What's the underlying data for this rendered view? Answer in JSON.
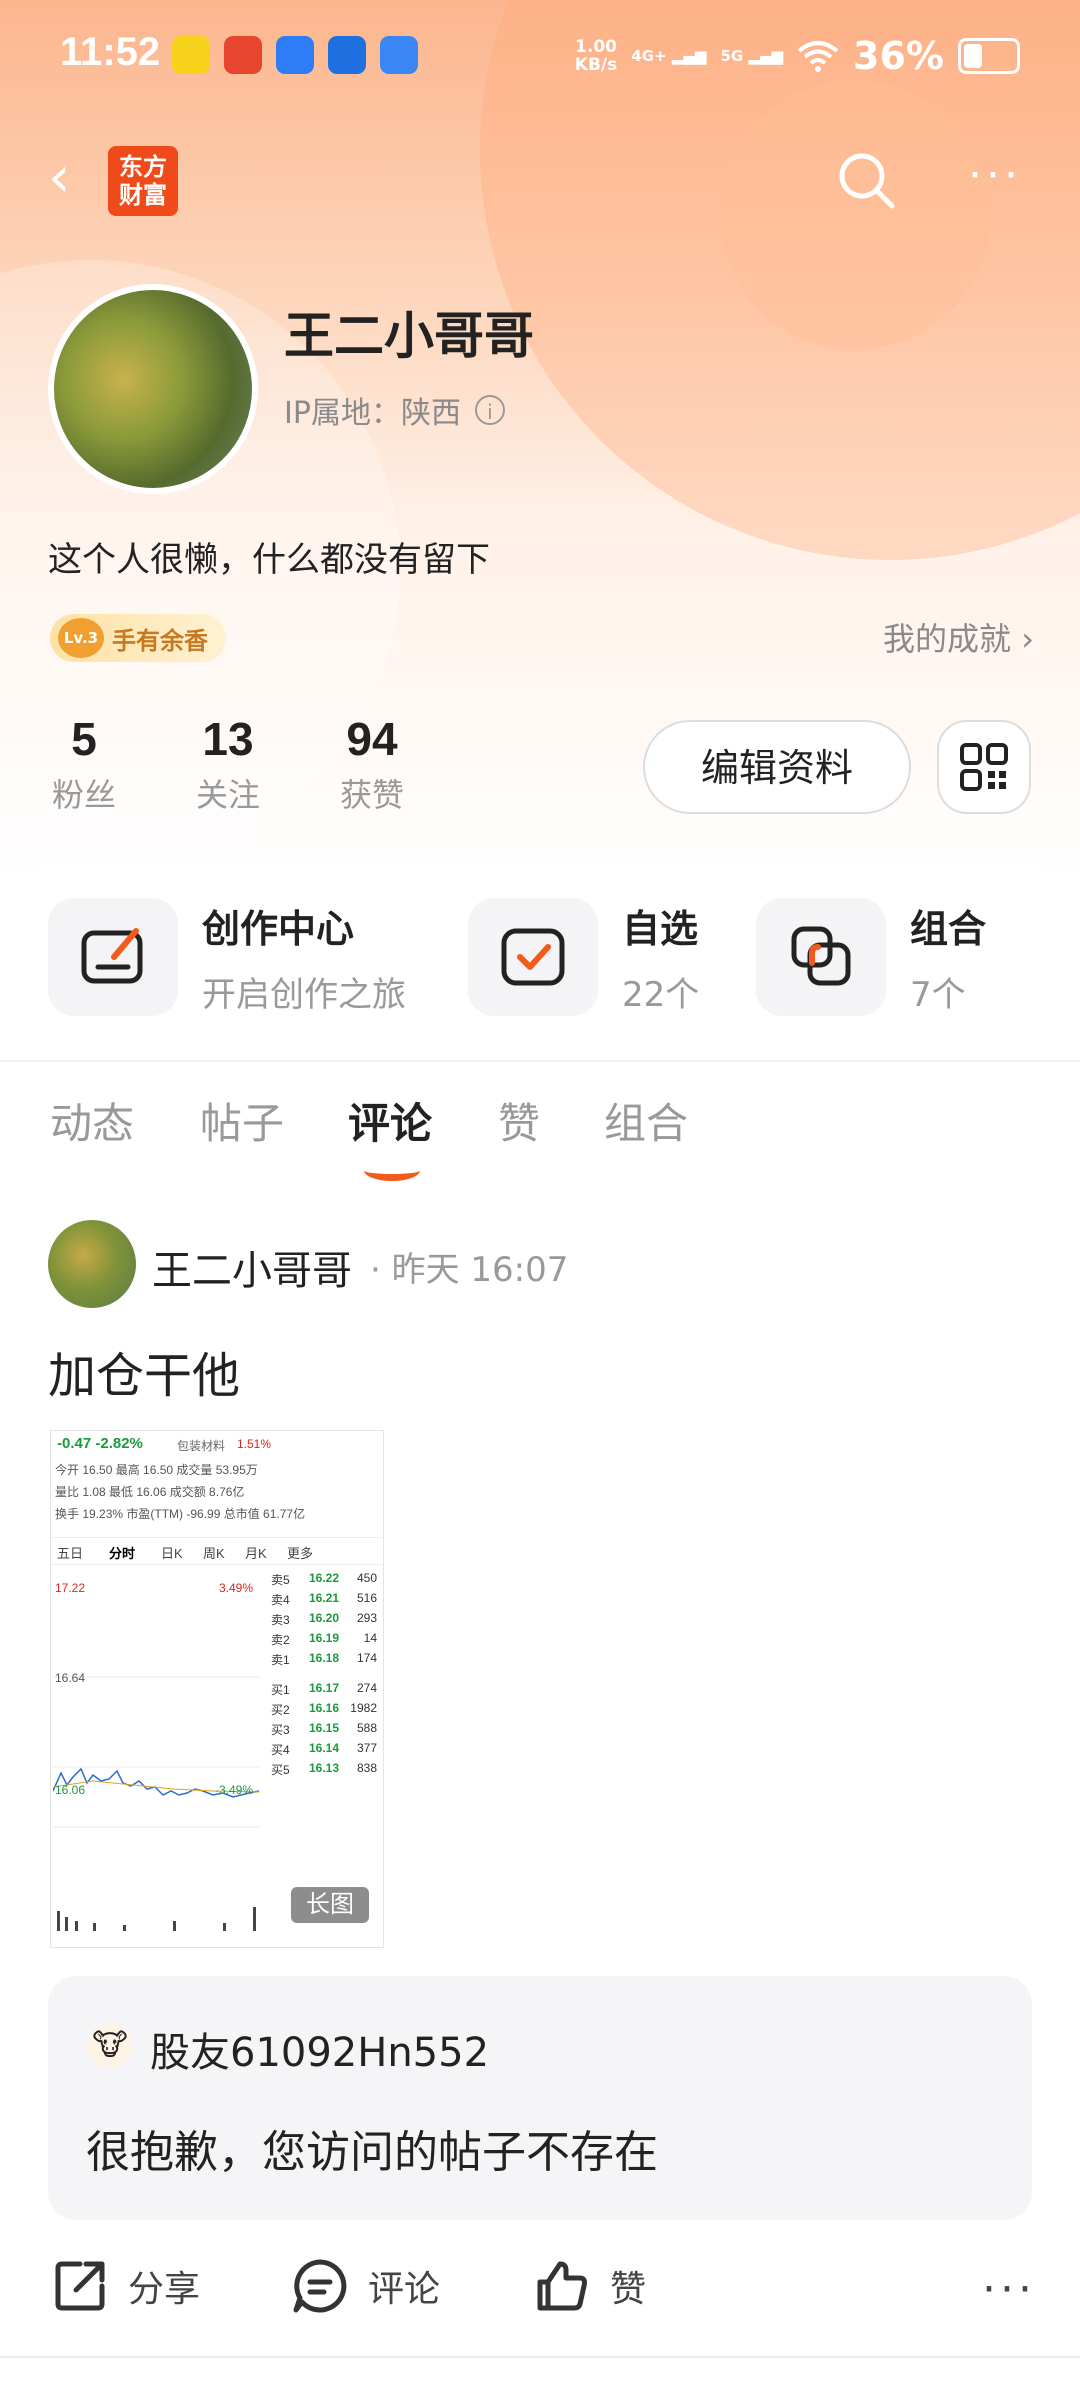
{
  "status_bar": {
    "time": "11:52",
    "network_speed_value": "1.00",
    "network_speed_unit": "KB/s",
    "signal_1": "4G+",
    "signal_2": "5G",
    "battery": "36%",
    "app_icon_colors": [
      "#f7d21b",
      "#e8452e",
      "#2e7cf6",
      "#1f6fe0",
      "#3a86f5"
    ]
  },
  "nav": {
    "logo_line1": "东方",
    "logo_line2": "财富",
    "back_icon": "chevron-left-icon",
    "search_icon": "search-icon",
    "more_icon": "more-dots-icon"
  },
  "profile": {
    "username": "王二小哥哥",
    "ip_label": "IP属地：陕西",
    "bio": "这个人很懒，什么都没有留下",
    "level_badge": "Lv.3",
    "level_title": "手有余香",
    "achievements": "我的成就"
  },
  "stats": [
    {
      "value": "5",
      "label": "粉丝"
    },
    {
      "value": "13",
      "label": "关注"
    },
    {
      "value": "94",
      "label": "获赞"
    }
  ],
  "edit_profile_label": "编辑资料",
  "quick_actions": [
    {
      "title": "创作中心",
      "subtitle": "开启创作之旅"
    },
    {
      "title": "自选",
      "subtitle": "22个"
    },
    {
      "title": "组合",
      "subtitle": "7个"
    }
  ],
  "tabs": [
    "动态",
    "帖子",
    "评论",
    "赞",
    "组合"
  ],
  "active_tab": "评论",
  "post": {
    "author": "王二小哥哥",
    "time": "· 昨天 16:07",
    "text": "加仓干他",
    "image_tag": "长图",
    "screenshot": {
      "change": "-0.47  -2.82%",
      "sector": "包装材料",
      "sector_change": "1.51%",
      "rows": [
        "今开  16.50  最高  16.50  成交量  53.95万",
        "量比  1.08  最低  16.06  成交额  8.76亿",
        "换手  19.23%  市盈(TTM)  -96.99  总市值  61.77亿"
      ],
      "kline_tabs": [
        "五日",
        "分时",
        "日K",
        "周K",
        "月K",
        "更多"
      ],
      "price_high": "17.22",
      "price_mid": "16.64",
      "price_low": "16.06",
      "pct_high": "3.49%",
      "pct_low": "-3.49%",
      "book_asks": [
        {
          "k": "卖5",
          "p": "16.22",
          "v": "450"
        },
        {
          "k": "卖4",
          "p": "16.21",
          "v": "516"
        },
        {
          "k": "卖3",
          "p": "16.20",
          "v": "293"
        },
        {
          "k": "卖2",
          "p": "16.19",
          "v": "14"
        },
        {
          "k": "卖1",
          "p": "16.18",
          "v": "174"
        }
      ],
      "book_bids": [
        {
          "k": "买1",
          "p": "16.17",
          "v": "274"
        },
        {
          "k": "买2",
          "p": "16.16",
          "v": "1982"
        },
        {
          "k": "买3",
          "p": "16.15",
          "v": "588"
        },
        {
          "k": "买4",
          "p": "16.14",
          "v": "377"
        },
        {
          "k": "买5",
          "p": "16.13",
          "v": "838"
        }
      ]
    }
  },
  "quote": {
    "user": "股友61092Hn552",
    "message": "很抱歉，您访问的帖子不存在"
  },
  "actions": {
    "share": "分享",
    "comment": "评论",
    "like": "赞"
  },
  "colors": {
    "accent": "#f35a1c",
    "logo_bg": "#ee4a1a",
    "down_green": "#1a9b3a"
  }
}
